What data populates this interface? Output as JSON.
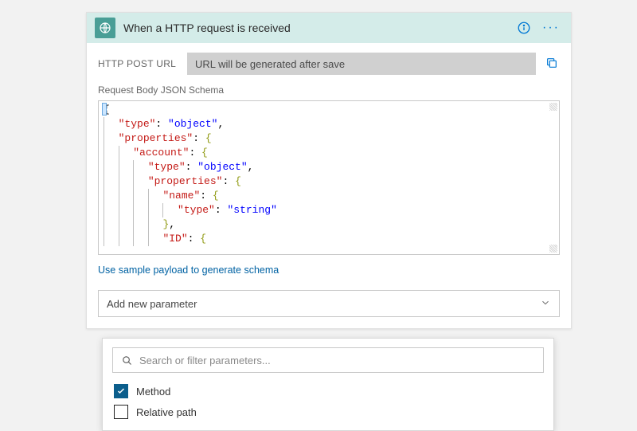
{
  "card": {
    "title": "When a HTTP request is received",
    "url_label": "HTTP POST URL",
    "url_placeholder": "URL will be generated after save",
    "schema_label": "Request Body JSON Schema",
    "sample_link": "Use sample payload to generate schema",
    "add_param_label": "Add new parameter"
  },
  "schema_json": {
    "type": "object",
    "properties": {
      "account": {
        "type": "object",
        "properties": {
          "name": {
            "type": "string"
          },
          "ID": {}
        }
      }
    }
  },
  "code_lines": [
    {
      "indent": 0,
      "tokens": [
        {
          "t": "{",
          "c": "punc"
        }
      ]
    },
    {
      "indent": 2,
      "tokens": [
        {
          "t": "\"type\"",
          "c": "key"
        },
        {
          "t": ": ",
          "c": "punc"
        },
        {
          "t": "\"object\"",
          "c": "str"
        },
        {
          "t": ",",
          "c": "punc"
        }
      ]
    },
    {
      "indent": 2,
      "tokens": [
        {
          "t": "\"properties\"",
          "c": "key"
        },
        {
          "t": ": ",
          "c": "punc"
        },
        {
          "t": "{",
          "c": "brace"
        }
      ]
    },
    {
      "indent": 4,
      "tokens": [
        {
          "t": "\"account\"",
          "c": "key"
        },
        {
          "t": ": ",
          "c": "punc"
        },
        {
          "t": "{",
          "c": "brace"
        }
      ]
    },
    {
      "indent": 6,
      "tokens": [
        {
          "t": "\"type\"",
          "c": "key"
        },
        {
          "t": ": ",
          "c": "punc"
        },
        {
          "t": "\"object\"",
          "c": "str"
        },
        {
          "t": ",",
          "c": "punc"
        }
      ]
    },
    {
      "indent": 6,
      "tokens": [
        {
          "t": "\"properties\"",
          "c": "key"
        },
        {
          "t": ": ",
          "c": "punc"
        },
        {
          "t": "{",
          "c": "brace"
        }
      ]
    },
    {
      "indent": 8,
      "tokens": [
        {
          "t": "\"name\"",
          "c": "key"
        },
        {
          "t": ": ",
          "c": "punc"
        },
        {
          "t": "{",
          "c": "brace"
        }
      ]
    },
    {
      "indent": 10,
      "tokens": [
        {
          "t": "\"type\"",
          "c": "key"
        },
        {
          "t": ": ",
          "c": "punc"
        },
        {
          "t": "\"string\"",
          "c": "str"
        }
      ]
    },
    {
      "indent": 8,
      "tokens": [
        {
          "t": "}",
          "c": "brace"
        },
        {
          "t": ",",
          "c": "punc"
        }
      ]
    },
    {
      "indent": 8,
      "tokens": [
        {
          "t": "\"ID\"",
          "c": "key"
        },
        {
          "t": ": ",
          "c": "punc"
        },
        {
          "t": "{",
          "c": "brace"
        }
      ]
    }
  ],
  "dropdown": {
    "search_placeholder": "Search or filter parameters...",
    "options": [
      {
        "label": "Method",
        "checked": true
      },
      {
        "label": "Relative path",
        "checked": false
      }
    ]
  }
}
